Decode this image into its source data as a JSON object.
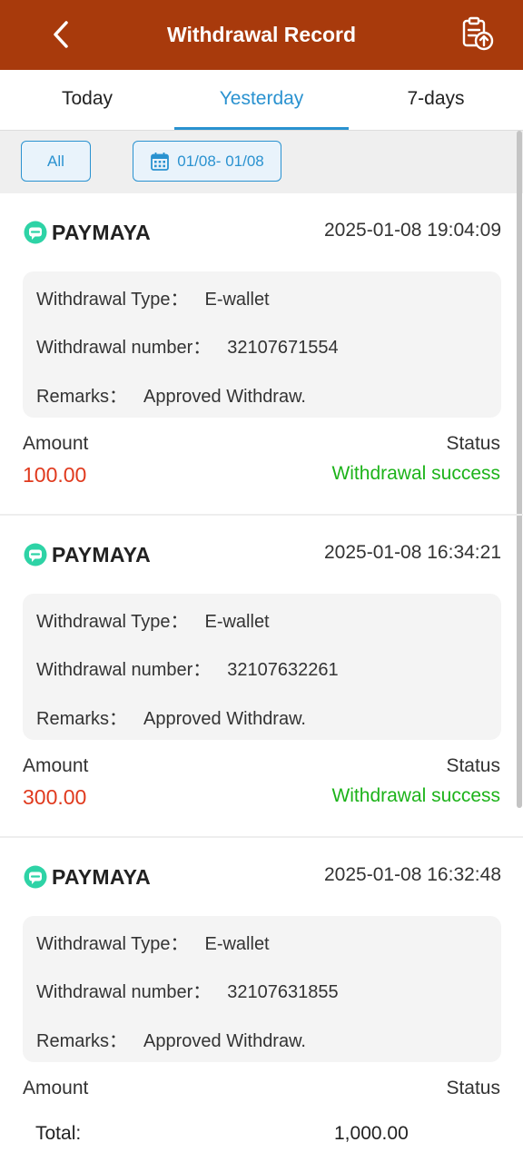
{
  "header": {
    "title": "Withdrawal Record",
    "back_icon": "chevron-left-icon",
    "record_icon": "clipboard-upload-icon",
    "background_color": "#a83a0c"
  },
  "tabs": [
    {
      "label": "Today",
      "active": false
    },
    {
      "label": "Yesterday",
      "active": true
    },
    {
      "label": "7-days",
      "active": false
    }
  ],
  "filters": {
    "all_label": "All",
    "date_icon": "calendar-icon",
    "date_range": "01/08- 01/08"
  },
  "records": [
    {
      "channel": "PAYMAYA",
      "time": "2025-01-08 19:04:09",
      "type_label": "Withdrawal Type：",
      "type_value": "E-wallet",
      "number_label": "Withdrawal number：",
      "number_value": "32107671554",
      "remarks_label": "Remarks：",
      "remarks_value": "Approved Withdraw.",
      "amount_label": "Amount",
      "amount": "100.00",
      "status_label": "Status",
      "status": "Withdrawal success"
    },
    {
      "channel": "PAYMAYA",
      "time": "2025-01-08 16:34:21",
      "type_label": "Withdrawal Type：",
      "type_value": "E-wallet",
      "number_label": "Withdrawal number：",
      "number_value": "32107632261",
      "remarks_label": "Remarks：",
      "remarks_value": "Approved Withdraw.",
      "amount_label": "Amount",
      "amount": "300.00",
      "status_label": "Status",
      "status": "Withdrawal success"
    },
    {
      "channel": "PAYMAYA",
      "time": "2025-01-08 16:32:48",
      "type_label": "Withdrawal Type：",
      "type_value": "E-wallet",
      "number_label": "Withdrawal number：",
      "number_value": "32107631855",
      "remarks_label": "Remarks：",
      "remarks_value": "Approved Withdraw.",
      "amount_label": "Amount",
      "amount": "",
      "status_label": "Status",
      "status": ""
    }
  ],
  "footer": {
    "total_label": "Total:",
    "total_value": "1,000.00"
  },
  "colors": {
    "accent": "#2a92d0",
    "amount": "#e03a1e",
    "success": "#1db31a",
    "paymaya_logo": "#2ed3a6"
  }
}
